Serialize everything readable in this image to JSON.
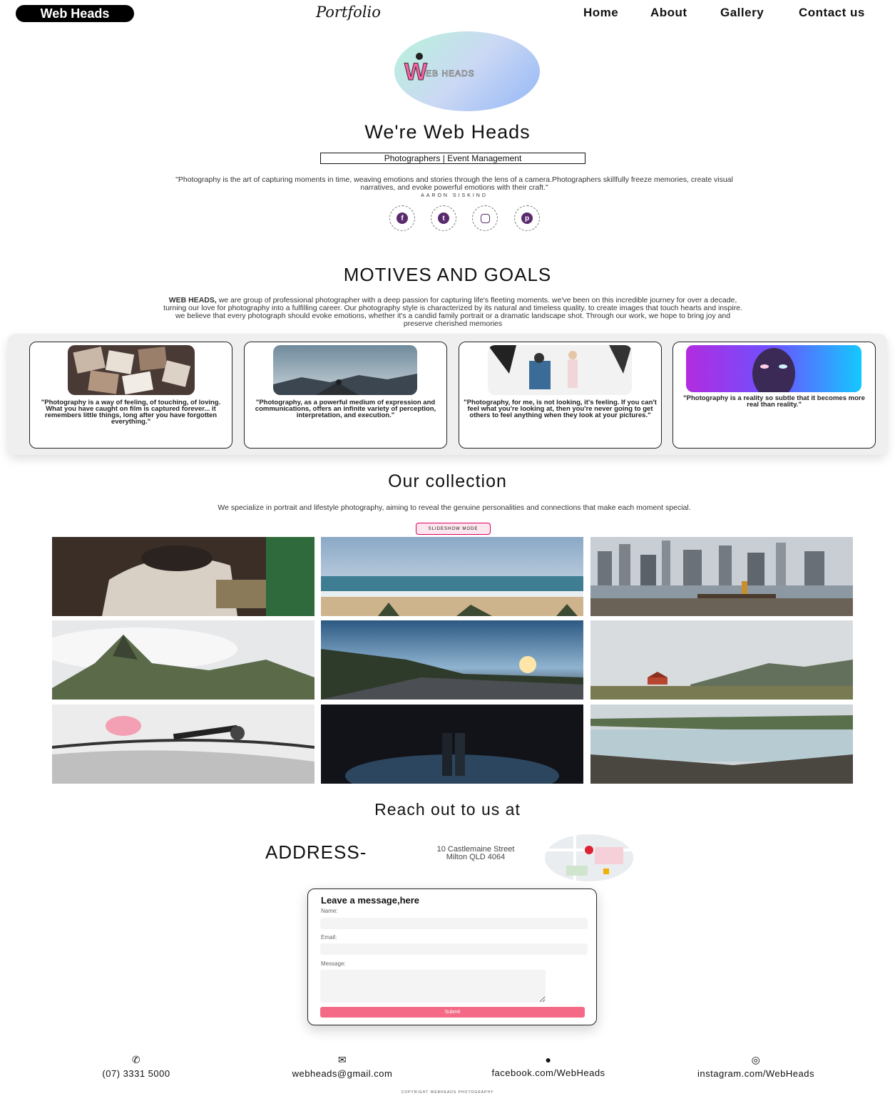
{
  "header": {
    "brand": "Web Heads",
    "script_title": "Portfolio",
    "nav": [
      "Home",
      "About",
      "Gallery",
      "Contact us"
    ]
  },
  "hero": {
    "heading": "We're Web Heads",
    "tagline": "Photographers | Event Management",
    "quote": "\"Photography is the art of capturing moments in time, weaving emotions and stories through the lens of a camera.Photographers skillfully freeze memories, create visual narratives, and evoke powerful emotions with their craft.\"",
    "quote_author": "AARON SISKIND",
    "social_icons": [
      "facebook-icon",
      "twitter-icon",
      "instagram-icon",
      "pinterest-icon"
    ]
  },
  "motives": {
    "heading": "MOTIVES AND GOALS",
    "lead": "WEB HEADS,",
    "body": " we are group of professional photographer with a deep passion for capturing life's fleeting moments. we've been on this incredible journey for over a decade, turning our love for photography into a fulfilling career. Our photography style is characterized by its natural and timeless quality. to create images that touch hearts and inspire. we believe that every photograph should evoke emotions, whether it's a candid family portrait or a dramatic landscape shot. Through our work, we hope to bring joy and preserve cherished memories"
  },
  "cards": [
    {
      "quote": "\"Photography is a way of feeling, of touching, of loving. What you have caught on film is captured forever... it remembers little things, long after you have forgotten everything.\""
    },
    {
      "quote": "\"Photography, as a powerful medium of expression and communications, offers an infinite variety of perception, interpretation, and execution.\""
    },
    {
      "quote": "\"Photography, for me, is not looking, it's feeling. If you can't feel what you're looking at, then you're never going to get others to feel anything when they look at your pictures.\""
    },
    {
      "quote": "\"Photography is a reality so subtle that it becomes more real than reality.\""
    }
  ],
  "collection": {
    "heading": "Our collection",
    "text": "We specialize in portrait and lifestyle photography, aiming to reveal the genuine personalities and connections that make each moment special.",
    "slideshow_label": "SLIDESHOW MODE"
  },
  "reach": {
    "heading": "Reach out to us at",
    "address_label": "ADDRESS-",
    "address_line1": "10 Castlemaine Street",
    "address_line2": "Milton QLD 4064"
  },
  "form": {
    "title": "Leave a message,here",
    "name_label": "Name:",
    "email_label": "Email:",
    "message_label": "Message:",
    "submit_label": "Submit"
  },
  "contact": {
    "phone": "(07) 3331 5000",
    "email": "webheads@gmail.com",
    "facebook": "facebook.com/WebHeads",
    "instagram": "instagram.com/WebHeads"
  },
  "footer": {
    "copyright": "COPYRIGHT WEBHEADS PHOTOGRAPHY"
  }
}
